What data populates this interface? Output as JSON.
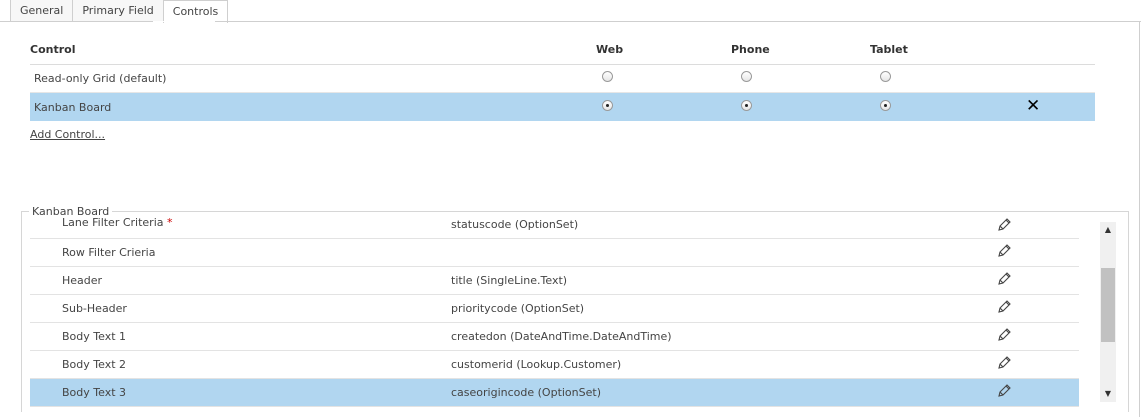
{
  "tabs": [
    {
      "label": "General"
    },
    {
      "label": "Primary Field"
    },
    {
      "label": "Controls"
    }
  ],
  "controls_table": {
    "headers": {
      "control": "Control",
      "web": "Web",
      "phone": "Phone",
      "tablet": "Tablet"
    },
    "rows": [
      {
        "name": "Read-only Grid (default)",
        "web": false,
        "phone": false,
        "tablet": false,
        "selected": false
      },
      {
        "name": "Kanban Board",
        "web": true,
        "phone": true,
        "tablet": true,
        "selected": true
      }
    ],
    "remove_icon": "close-icon"
  },
  "add_control_label": "Add Control...",
  "kanban_group": {
    "legend": "Kanban Board",
    "required_mark": "*",
    "properties": [
      {
        "name": "Lane Filter Criteria",
        "required": true,
        "value": "statuscode (OptionSet)"
      },
      {
        "name": "Row Filter Crieria",
        "value": ""
      },
      {
        "name": "Header",
        "value": "title (SingleLine.Text)"
      },
      {
        "name": "Sub-Header",
        "value": "prioritycode (OptionSet)"
      },
      {
        "name": "Body Text 1",
        "value": "createdon (DateAndTime.DateAndTime)"
      },
      {
        "name": "Body Text 2",
        "value": "customerid (Lookup.Customer)"
      },
      {
        "name": "Body Text 3",
        "value": "caseorigincode (OptionSet)",
        "selected": true
      }
    ],
    "edit_icon": "pencil-icon"
  },
  "scroll": {
    "up_icon": "scroll-up-arrow-icon",
    "down_icon": "scroll-down-arrow-icon"
  },
  "colors": {
    "selected_row": "#b1d6f0",
    "border": "#d6d6d6"
  }
}
